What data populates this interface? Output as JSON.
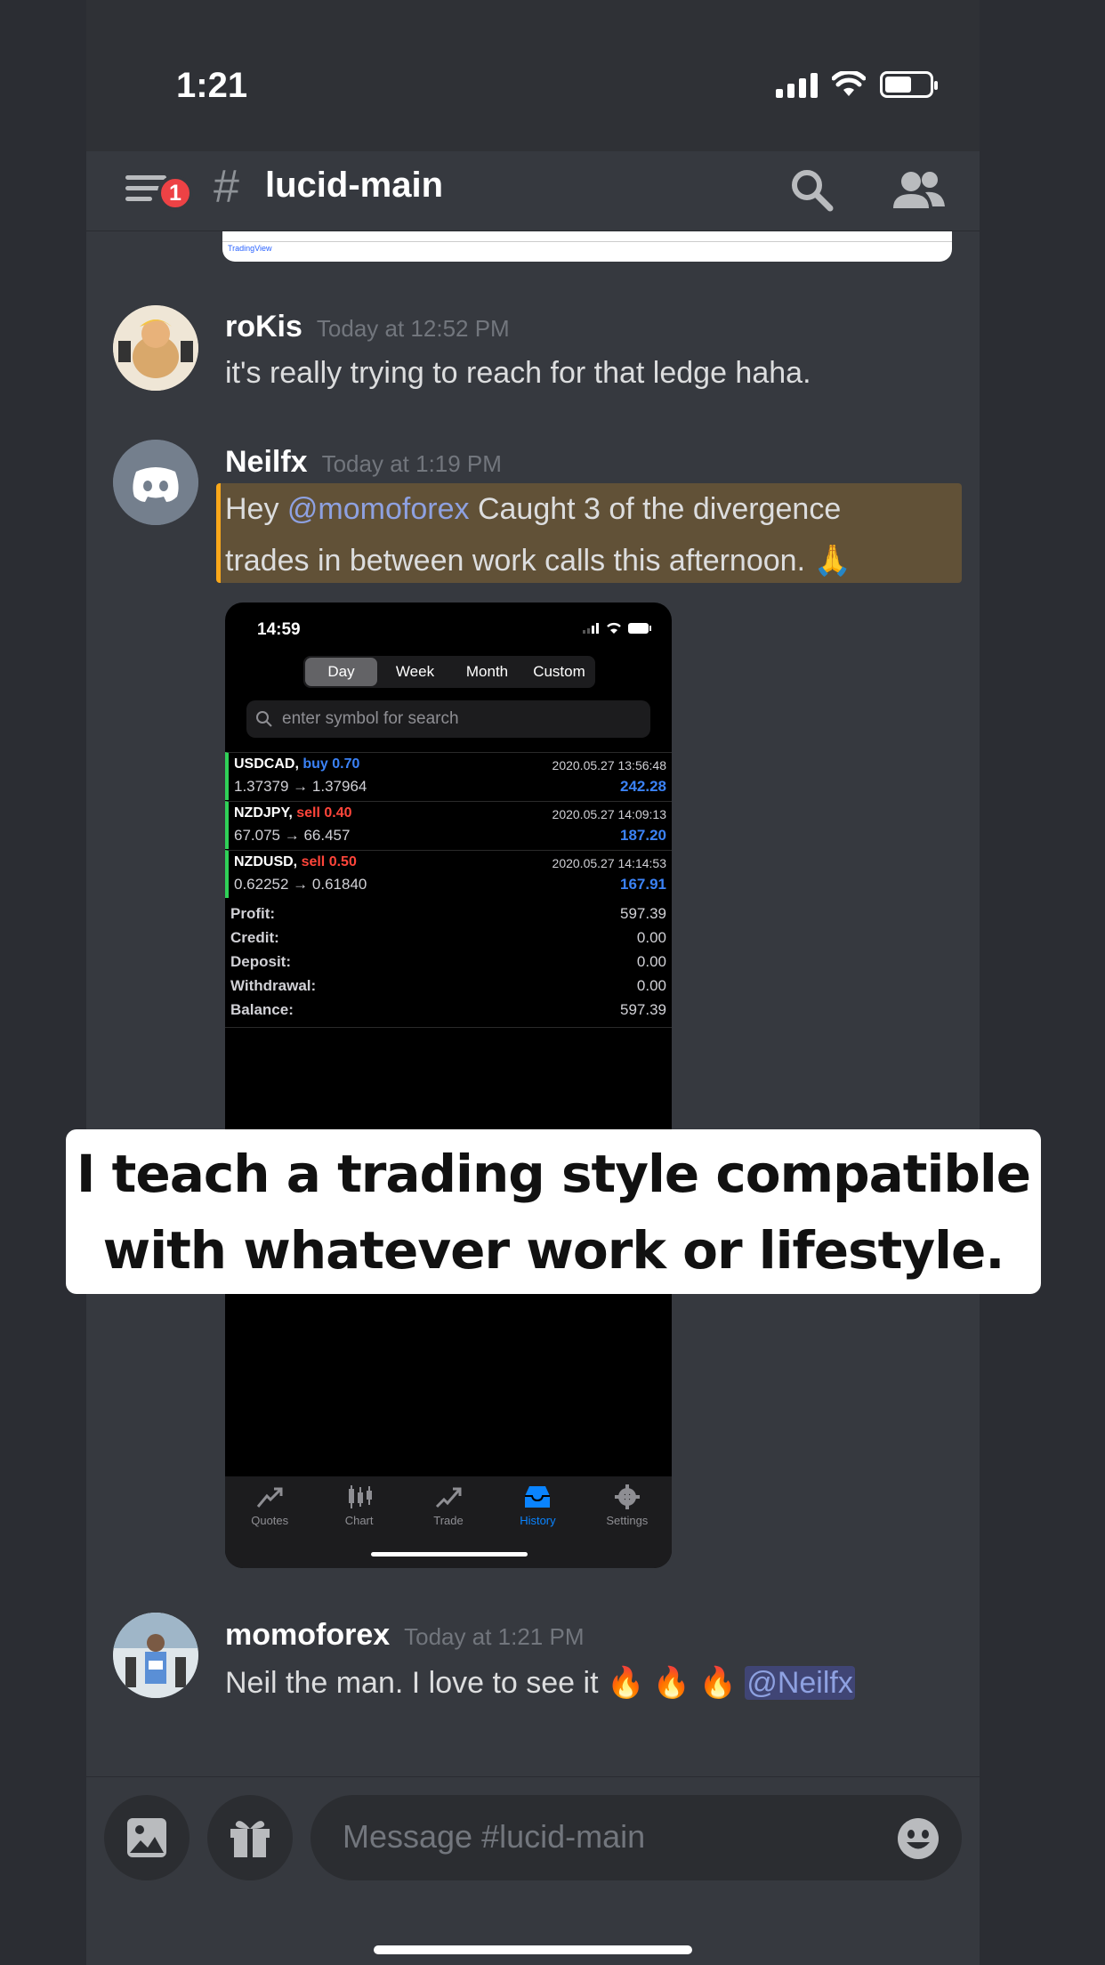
{
  "status_bar": {
    "time": "1:21"
  },
  "header": {
    "badge_count": "1",
    "hash": "#",
    "channel_name": "lucid-main"
  },
  "chart_tail": {
    "watermark": "TradingView"
  },
  "messages": [
    {
      "author": "roKis",
      "timestamp": "Today at 12:52 PM",
      "text": "it's really trying to reach for that ledge haha."
    },
    {
      "author": "Neilfx",
      "timestamp": "Today at 1:19 PM",
      "mention": "@momoforex",
      "line1_rest": " Caught 3 of the divergence",
      "line2": "trades in between work calls this afternoon. 🙏",
      "prefix": "Hey "
    },
    {
      "author": "momoforex",
      "timestamp": "Today at 1:21 PM",
      "text": "Neil the man. I love to see it 🔥 🔥 🔥 ",
      "mention": "@Neilfx"
    }
  ],
  "screenshot": {
    "time": "14:59",
    "segments": [
      "Day",
      "Week",
      "Month",
      "Custom"
    ],
    "active_segment": "Day",
    "search_placeholder": "enter symbol for search",
    "trades": [
      {
        "symbol": "USDCAD,",
        "side": "buy 0.70",
        "side_type": "buy",
        "range": "1.37379 → 1.37964",
        "datetime": "2020.05.27 13:56:48",
        "profit": "242.28"
      },
      {
        "symbol": "NZDJPY,",
        "side": "sell 0.40",
        "side_type": "sell",
        "range": "67.075 → 66.457",
        "datetime": "2020.05.27 14:09:13",
        "profit": "187.20"
      },
      {
        "symbol": "NZDUSD,",
        "side": "sell 0.50",
        "side_type": "sell",
        "range": "0.62252 → 0.61840",
        "datetime": "2020.05.27 14:14:53",
        "profit": "167.91"
      }
    ],
    "summary": [
      {
        "label": "Profit:",
        "value": "597.39"
      },
      {
        "label": "Credit:",
        "value": "0.00"
      },
      {
        "label": "Deposit:",
        "value": "0.00"
      },
      {
        "label": "Withdrawal:",
        "value": "0.00"
      },
      {
        "label": "Balance:",
        "value": "597.39"
      }
    ],
    "tabs": [
      "Quotes",
      "Chart",
      "Trade",
      "History",
      "Settings"
    ],
    "active_tab": "History"
  },
  "caption": {
    "line1": "I teach a trading style compatible",
    "line2": "with whatever work or lifestyle."
  },
  "composer": {
    "placeholder": "Message #lucid-main"
  },
  "colors": {
    "background": "#36393f",
    "mention": "#8ea1e1",
    "highlight_border": "#faa81a",
    "buy": "#3b82f6",
    "sell": "#ff453a",
    "history_tab": "#0a84ff"
  }
}
